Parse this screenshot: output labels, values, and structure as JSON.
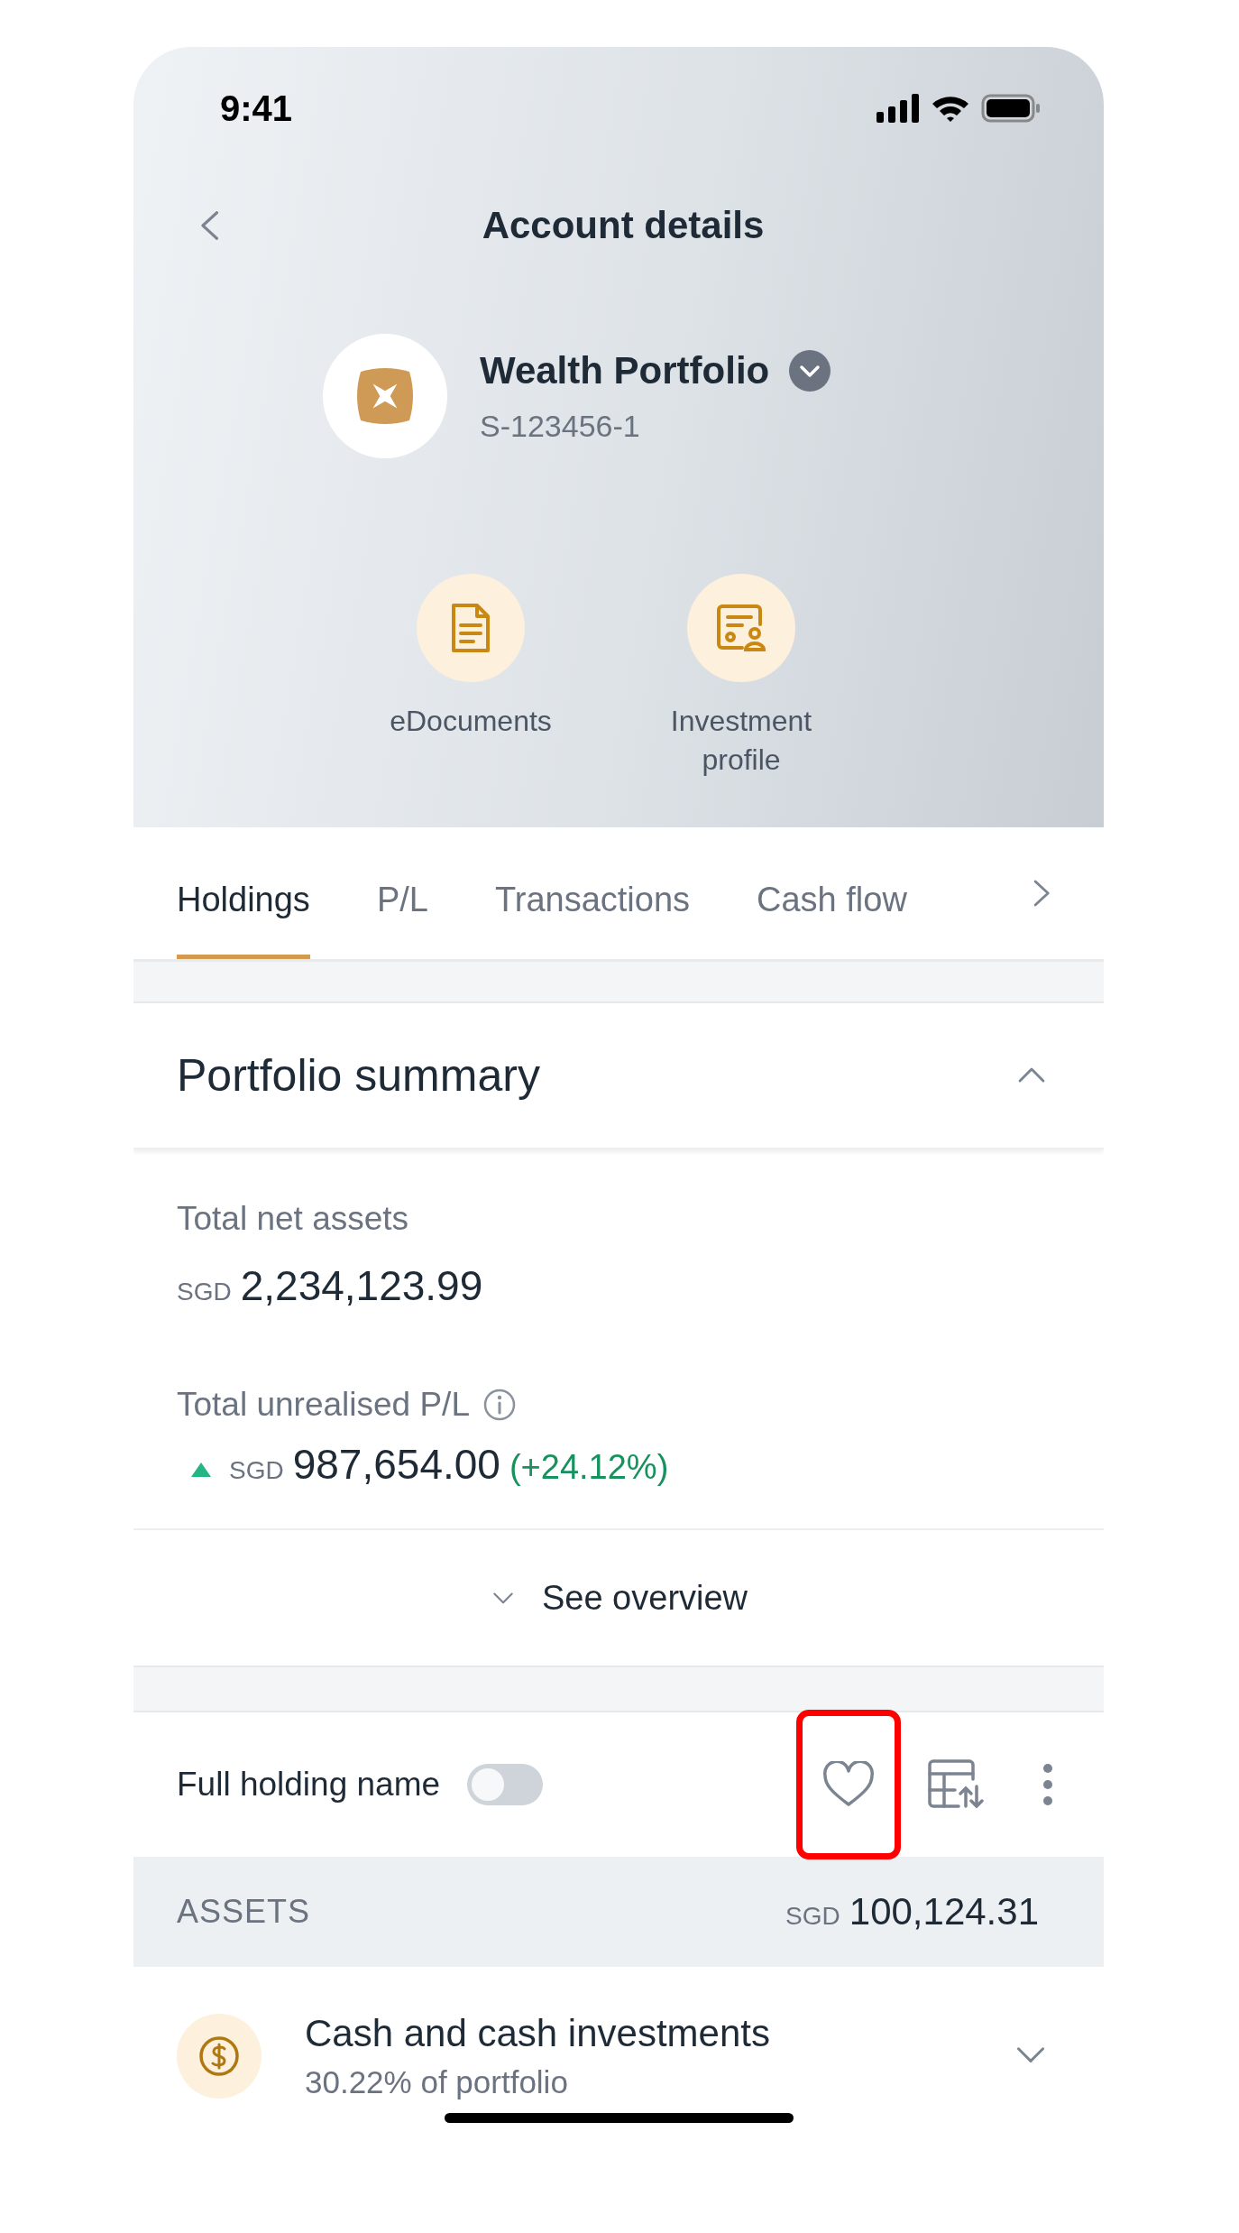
{
  "status_bar": {
    "time": "9:41"
  },
  "header": {
    "title": "Account details"
  },
  "account": {
    "name": "Wealth Portfolio",
    "number": "S-123456-1"
  },
  "quick_actions": [
    {
      "label": "eDocuments",
      "kind": "document"
    },
    {
      "label": "Investment profile",
      "kind": "profile"
    }
  ],
  "tabs": [
    {
      "label": "Holdings",
      "selected": true
    },
    {
      "label": "P/L",
      "selected": false
    },
    {
      "label": "Transactions",
      "selected": false
    },
    {
      "label": "Cash flow",
      "selected": false
    }
  ],
  "summary": {
    "title": "Portfolio summary",
    "expanded": true,
    "net_assets": {
      "label": "Total net assets",
      "currency": "SGD",
      "amount": "2,234,123.99"
    },
    "unrealised": {
      "label": "Total unrealised P/L",
      "rising": true,
      "currency": "SGD",
      "amount": "987,654.00",
      "change": "(+24.12%)"
    },
    "overview_link": "See overview"
  },
  "holdings_toolbar": {
    "toggle_label": "Full holding name",
    "toggle_on": false,
    "tools": [
      {
        "kind": "favorite",
        "highlighted": true
      },
      {
        "kind": "table-sort"
      },
      {
        "kind": "more"
      }
    ]
  },
  "assets": {
    "label": "ASSETS",
    "currency": "SGD",
    "total": "100,124.31"
  },
  "categories": [
    {
      "name": "Cash and cash investments",
      "share": "30.22% of portfolio",
      "expanded": false
    }
  ]
}
